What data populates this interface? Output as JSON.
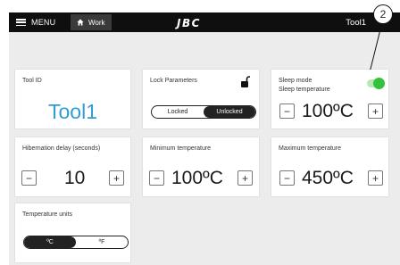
{
  "callout": "2",
  "topbar": {
    "menu_label": "MENU",
    "work_tab_label": "Work",
    "logo_text": "JBC",
    "tool_name": "Tool1"
  },
  "cards": {
    "tool_id": {
      "label": "Tool ID",
      "value": "Tool1"
    },
    "lock_parameters": {
      "label": "Lock Parameters",
      "options": [
        "Locked",
        "Unlocked"
      ],
      "selected": "Unlocked"
    },
    "sleep": {
      "label": "Sleep mode",
      "sublabel": "Sleep temperature",
      "toggle_on": true,
      "value": "100ºC"
    },
    "hibernation": {
      "label": "Hibernation delay (seconds)",
      "value": "10"
    },
    "min_temp": {
      "label": "Minimum temperature",
      "value": "100ºC"
    },
    "max_temp": {
      "label": "Maximum temperature",
      "value": "450ºC"
    },
    "units": {
      "label": "Temperature units",
      "options": [
        "ºC",
        "ºF"
      ],
      "selected": "ºC"
    }
  },
  "buttons": {
    "minus": "−",
    "plus": "+"
  },
  "colors": {
    "accent_blue": "#2f9cd6",
    "toggle_green": "#33c23a",
    "topbar": "#0f0f0f"
  }
}
